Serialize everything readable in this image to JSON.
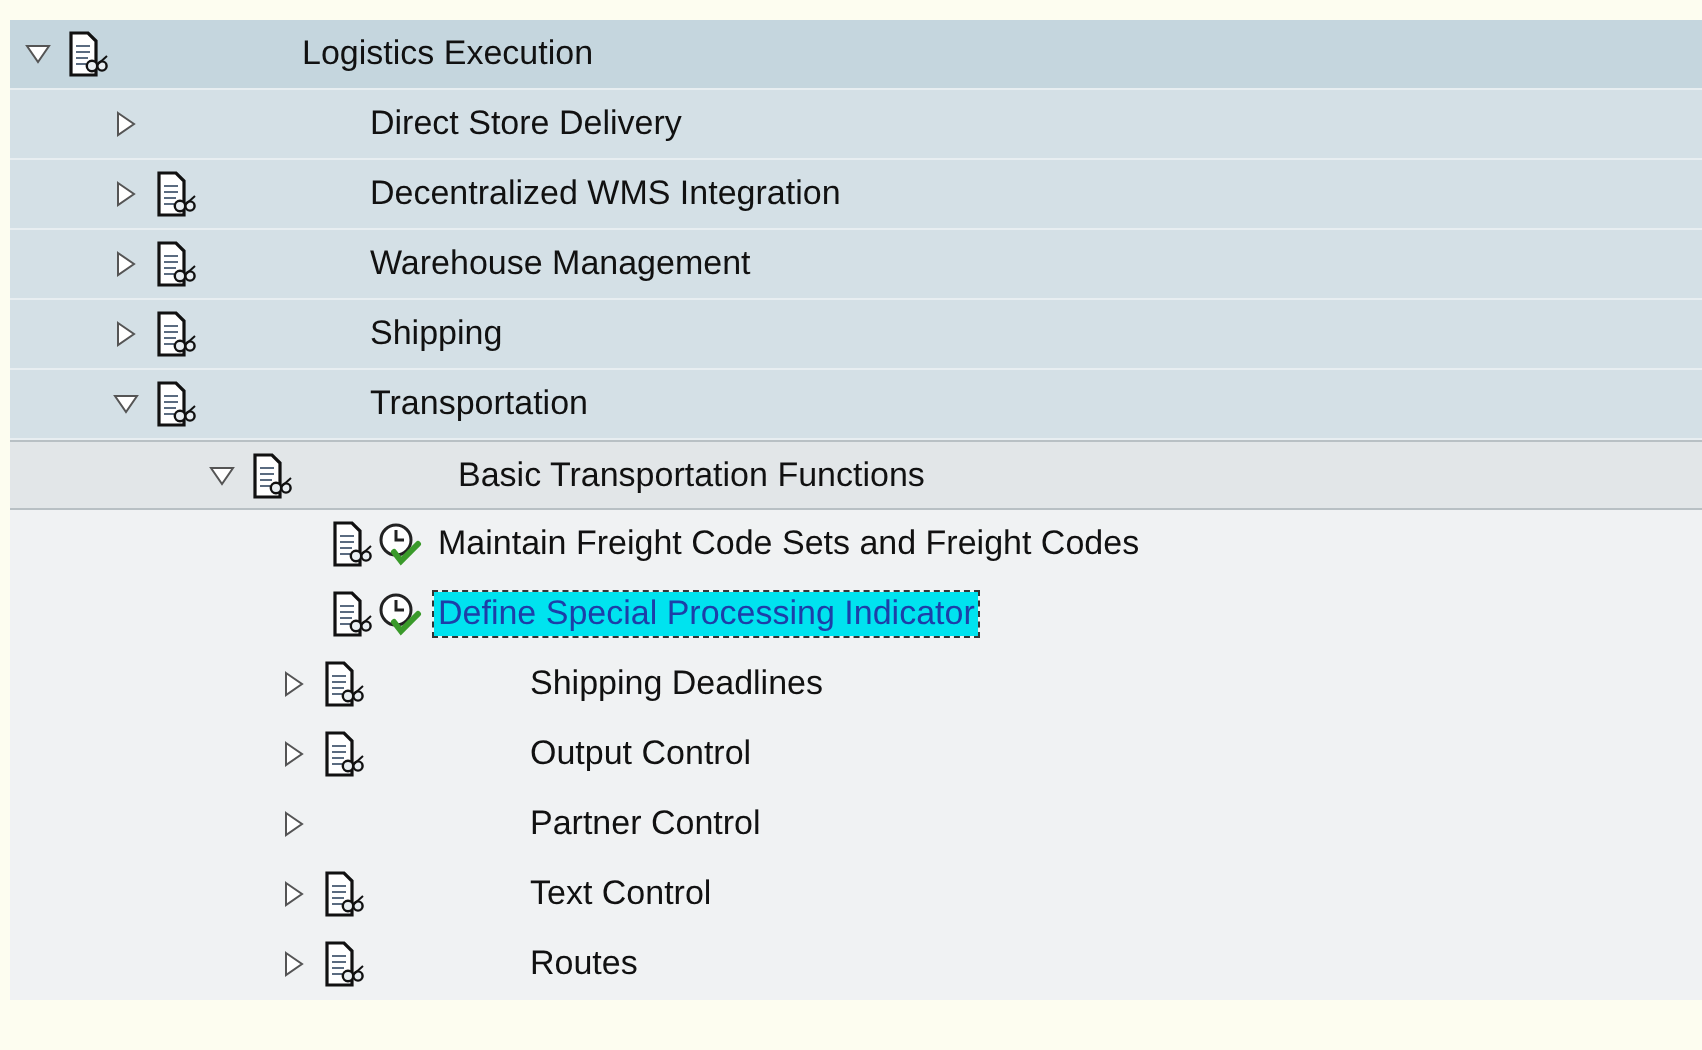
{
  "tree": [
    {
      "label": "Logistics Execution",
      "kind": "folder",
      "has_docs": true,
      "expanded": true,
      "selected": false,
      "children": [
        {
          "label": "Direct Store Delivery",
          "kind": "folder",
          "has_docs": false,
          "expanded": false,
          "selected": false
        },
        {
          "label": "Decentralized WMS Integration",
          "kind": "folder",
          "has_docs": true,
          "expanded": false,
          "selected": false
        },
        {
          "label": "Warehouse Management",
          "kind": "folder",
          "has_docs": true,
          "expanded": false,
          "selected": false
        },
        {
          "label": "Shipping",
          "kind": "folder",
          "has_docs": true,
          "expanded": false,
          "selected": false
        },
        {
          "label": "Transportation",
          "kind": "folder",
          "has_docs": true,
          "expanded": true,
          "selected": false,
          "children": [
            {
              "label": "Basic Transportation Functions",
              "kind": "folder",
              "has_docs": true,
              "expanded": true,
              "selected": false,
              "children": [
                {
                  "label": "Maintain Freight Code Sets and Freight Codes",
                  "kind": "activity",
                  "has_docs": true,
                  "selected": false
                },
                {
                  "label": "Define Special Processing Indicator",
                  "kind": "activity",
                  "has_docs": true,
                  "selected": true
                },
                {
                  "label": "Shipping Deadlines",
                  "kind": "folder",
                  "has_docs": true,
                  "expanded": false,
                  "selected": false
                },
                {
                  "label": "Output Control",
                  "kind": "folder",
                  "has_docs": true,
                  "expanded": false,
                  "selected": false
                },
                {
                  "label": "Partner Control",
                  "kind": "folder",
                  "has_docs": false,
                  "expanded": false,
                  "selected": false
                },
                {
                  "label": "Text Control",
                  "kind": "folder",
                  "has_docs": true,
                  "expanded": false,
                  "selected": false
                },
                {
                  "label": "Routes",
                  "kind": "folder",
                  "has_docs": true,
                  "expanded": false,
                  "selected": false
                }
              ]
            }
          ]
        }
      ]
    }
  ]
}
